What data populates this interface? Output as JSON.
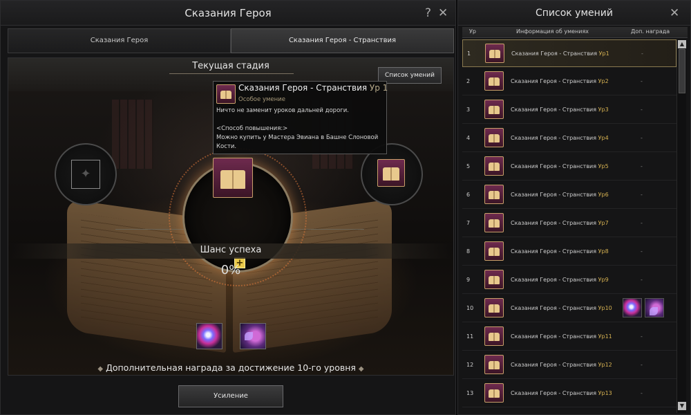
{
  "left_window": {
    "title": "Сказания Героя",
    "help_icon": "?",
    "close_icon": "✕",
    "tabs": [
      {
        "label": "Сказания Героя"
      },
      {
        "label": "Сказания Героя - Странствия"
      }
    ],
    "stage_label": "Текущая стадия",
    "skills_button": "Список умений",
    "chance_label": "Шанс успеха",
    "chance_value": "0%",
    "bonus_text": "Дополнительная награда за достижение 10-го уровня",
    "upgrade_button": "Усиление",
    "plus_icon": "+"
  },
  "tooltip": {
    "title": "Сказания Героя - Странствия",
    "level": "Ур 1",
    "subtitle": "Особое умение",
    "description": "Ничто не заменит уроков дальней дороги.",
    "method_title": "<Способ повышения:>",
    "method_text": "Можно купить у Мастера Эвиана в Башне Слоновой Кости."
  },
  "right_window": {
    "title": "Список умений",
    "close_icon": "✕",
    "columns": {
      "lv": "Ур",
      "info": "Информация об умениях",
      "reward": "Доп. награда"
    },
    "rows": [
      {
        "lv": "1",
        "name": "Сказания Героя - Странствия",
        "lvtag": "Ур1",
        "reward": "-"
      },
      {
        "lv": "2",
        "name": "Сказания Героя - Странствия",
        "lvtag": "Ур2",
        "reward": "-"
      },
      {
        "lv": "3",
        "name": "Сказания Героя - Странствия",
        "lvtag": "Ур3",
        "reward": "-"
      },
      {
        "lv": "4",
        "name": "Сказания Героя - Странствия",
        "lvtag": "Ур4",
        "reward": "-"
      },
      {
        "lv": "5",
        "name": "Сказания Героя - Странствия",
        "lvtag": "Ур5",
        "reward": "-"
      },
      {
        "lv": "6",
        "name": "Сказания Героя - Странствия",
        "lvtag": "Ур6",
        "reward": "-"
      },
      {
        "lv": "7",
        "name": "Сказания Героя - Странствия",
        "lvtag": "Ур7",
        "reward": "-"
      },
      {
        "lv": "8",
        "name": "Сказания Героя - Странствия",
        "lvtag": "Ур8",
        "reward": "-"
      },
      {
        "lv": "9",
        "name": "Сказания Героя - Странствия",
        "lvtag": "Ур9",
        "reward": "-"
      },
      {
        "lv": "10",
        "name": "Сказания Героя - Странствия",
        "lvtag": "Ур10",
        "reward": ""
      },
      {
        "lv": "11",
        "name": "Сказания Героя - Странствия",
        "lvtag": "Ур11",
        "reward": "-"
      },
      {
        "lv": "12",
        "name": "Сказания Героя - Странствия",
        "lvtag": "Ур12",
        "reward": "-"
      },
      {
        "lv": "13",
        "name": "Сказания Героя - Странствия",
        "lvtag": "Ур13",
        "reward": "-"
      }
    ],
    "scroll_up": "▲",
    "scroll_down": "▼"
  },
  "icons": {
    "skill": "book-icon",
    "reward_1": "orb-icon",
    "reward_2": "wing-book-icon",
    "empty_slot": "star-slot-icon"
  },
  "colors": {
    "level_tag": "#d8b352",
    "selection_border": "#8a7a50",
    "plus_button": "#e8c84a"
  }
}
